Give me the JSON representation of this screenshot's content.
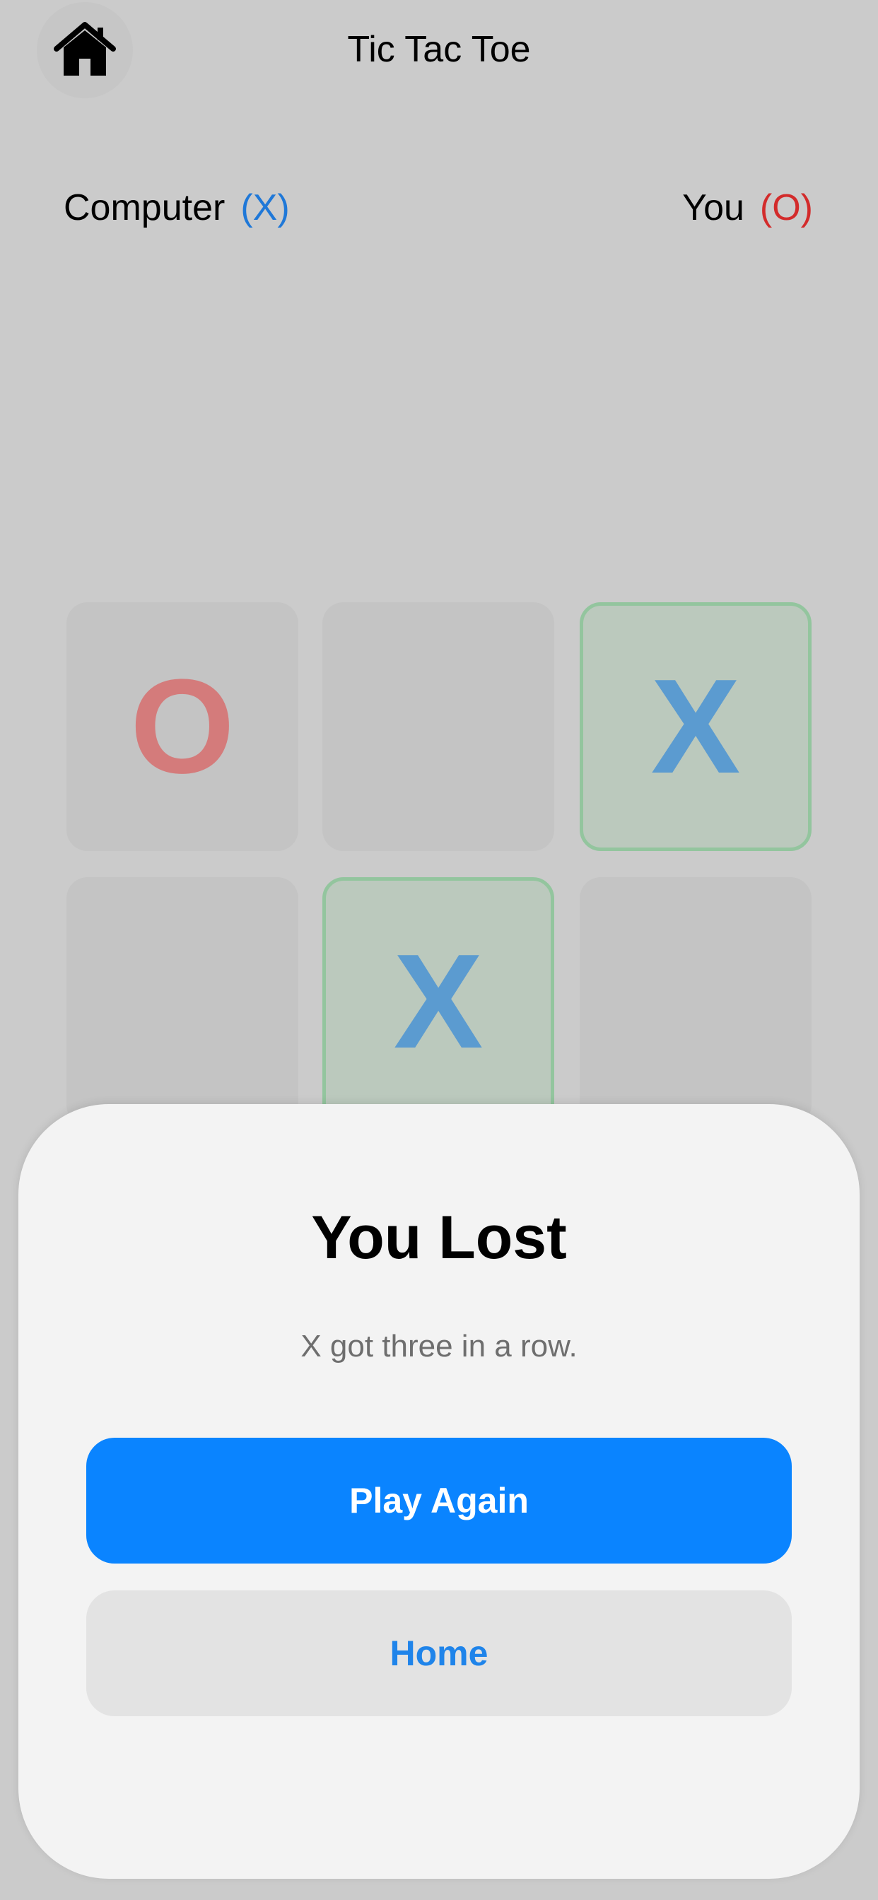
{
  "header": {
    "title": "Tic Tac Toe",
    "home_icon": "house-icon"
  },
  "players": {
    "computer": {
      "label": "Computer",
      "mark": "(X)"
    },
    "user": {
      "label": "You",
      "mark": "(O)"
    }
  },
  "board": {
    "cells": [
      "O",
      "",
      "X",
      "",
      "X",
      ""
    ],
    "winning_cells": [
      2,
      4
    ]
  },
  "result": {
    "title": "You Lost",
    "message": "X got three in a row.",
    "primary_button": "Play Again",
    "secondary_button": "Home"
  },
  "colors": {
    "accent": "#0a84ff",
    "x_mark": "#1f78d8",
    "o_mark": "#d32b2b",
    "win_border": "#93c59e"
  }
}
